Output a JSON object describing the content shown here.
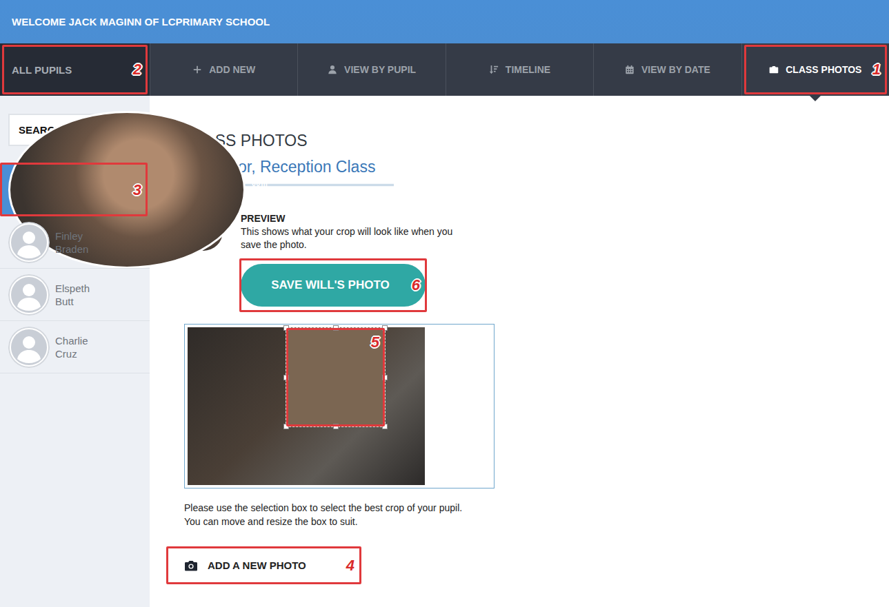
{
  "header": {
    "welcome": "WELCOME JACK MAGINN OF LCPRIMARY SCHOOL"
  },
  "all_pupils": {
    "label": "ALL PUPILS",
    "marker": "2"
  },
  "nav": {
    "tabs": [
      {
        "label": "ADD NEW",
        "selected": false,
        "marker": ""
      },
      {
        "label": "VIEW BY PUPIL",
        "selected": false,
        "marker": ""
      },
      {
        "label": "TIMELINE",
        "selected": false,
        "marker": ""
      },
      {
        "label": "VIEW BY DATE",
        "selected": false,
        "marker": ""
      },
      {
        "label": "CLASS PHOTOS",
        "selected": true,
        "marker": "1"
      }
    ]
  },
  "search": {
    "placeholder": "SEARCH PUPILS"
  },
  "pupils": [
    {
      "first": "Will",
      "last": "Arbor",
      "selected": true,
      "has_photo": true,
      "marker": "3"
    },
    {
      "first": "Finley",
      "last": "Braden",
      "selected": false,
      "has_photo": false,
      "marker": ""
    },
    {
      "first": "Elspeth",
      "last": "Butt",
      "selected": false,
      "has_photo": false,
      "marker": ""
    },
    {
      "first": "Charlie",
      "last": "Cruz",
      "selected": false,
      "has_photo": false,
      "marker": ""
    }
  ],
  "main": {
    "title": "CLASS PHOTOS",
    "subtitle": "Will Arbor, Reception Class",
    "preview": {
      "label": "PREVIEW",
      "text": "This shows what your crop will look like when you save the photo."
    },
    "save_button": {
      "label": "SAVE WILL'S PHOTO",
      "marker": "6"
    },
    "crop": {
      "marker": "5"
    },
    "instructions": [
      "Please use the selection box to select the best crop of your pupil.",
      "You can move and resize the box to suit."
    ],
    "add_photo": {
      "label": "ADD A NEW PHOTO",
      "marker": "4"
    }
  }
}
